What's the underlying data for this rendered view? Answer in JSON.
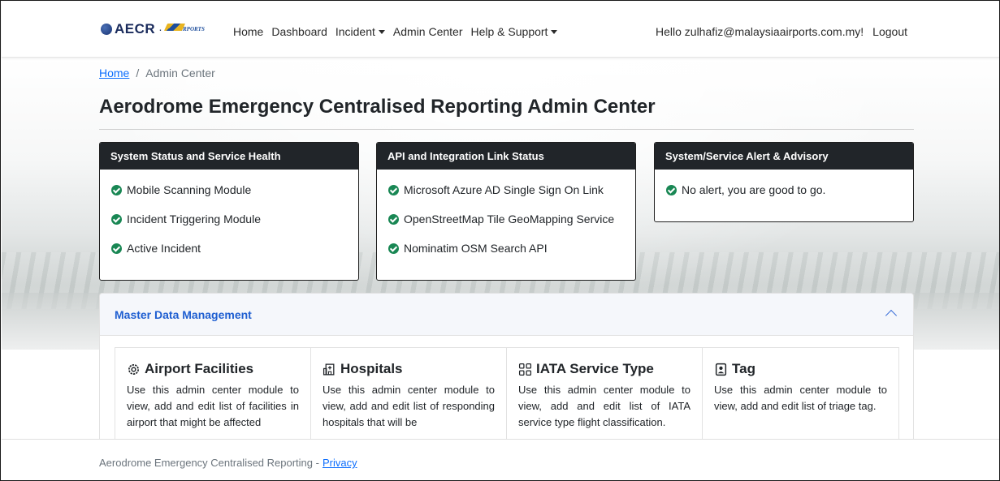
{
  "navbar": {
    "brand_text": "AECR",
    "brand_separator": "·",
    "brand_logo_text": "AIRPORTS",
    "links": [
      {
        "label": "Home",
        "dropdown": false
      },
      {
        "label": "Dashboard",
        "dropdown": false
      },
      {
        "label": "Incident",
        "dropdown": true
      },
      {
        "label": "Admin Center",
        "dropdown": false
      },
      {
        "label": "Help & Support",
        "dropdown": true
      }
    ],
    "greeting": "Hello zulhafiz@malaysiaairports.com.my!",
    "logout": "Logout"
  },
  "breadcrumb": {
    "home": "Home",
    "separator": "/",
    "current": "Admin Center"
  },
  "page_title": "Aerodrome Emergency Centralised Reporting Admin Center",
  "status_cards": [
    {
      "title": "System Status and Service Health",
      "items": [
        "Mobile Scanning Module",
        "Incident Triggering Module",
        "Active Incident"
      ]
    },
    {
      "title": "API and Integration Link Status",
      "items": [
        "Microsoft Azure AD Single Sign On Link",
        "OpenStreetMap Tile GeoMapping Service",
        "Nominatim OSM Search API"
      ]
    },
    {
      "title": "System/Service Alert & Advisory",
      "items": [
        "No alert, you are good to go."
      ]
    }
  ],
  "accordion": {
    "title": "Master Data Management",
    "modules": [
      {
        "title": "Airport Facilities",
        "icon": "gear-icon",
        "desc": "Use this admin center module to view, add and edit list of facilities in airport that might be affected"
      },
      {
        "title": "Hospitals",
        "icon": "hospital-icon",
        "desc": "Use this admin center module to view, add and edit list of responding hospitals that will be"
      },
      {
        "title": "IATA Service Type",
        "icon": "grid-icon",
        "desc": "Use this admin center module to view, add and edit list of IATA service type flight classification."
      },
      {
        "title": "Tag",
        "icon": "tag-icon",
        "desc": "Use this admin center module to view, add and edit list of triage tag."
      }
    ]
  },
  "footer": {
    "text": "Aerodrome Emergency Centralised Reporting -",
    "link": "Privacy"
  },
  "colors": {
    "status_ok": "#198754",
    "card_header": "#212529",
    "link": "#0d6efd",
    "accordion_title": "#1f5fd1"
  }
}
